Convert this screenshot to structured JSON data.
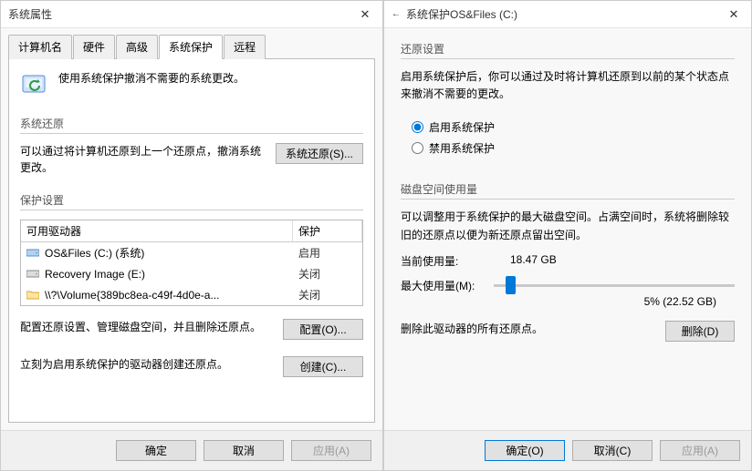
{
  "left": {
    "title": "系统属性",
    "tabs": [
      "计算机名",
      "硬件",
      "高级",
      "系统保护",
      "远程"
    ],
    "active_tab": 3,
    "intro_text": "使用系统保护撤消不需要的系统更改。",
    "section_restore": {
      "label": "系统还原",
      "text": "可以通过将计算机还原到上一个还原点，撤消系统更改。",
      "button": "系统还原(S)..."
    },
    "section_protect": {
      "label": "保护设置",
      "columns": {
        "drive": "可用驱动器",
        "protection": "保护"
      },
      "rows": [
        {
          "icon": "disk",
          "name": "OS&Files (C:) (系统)",
          "protection": "启用"
        },
        {
          "icon": "disk",
          "name": "Recovery Image (E:)",
          "protection": "关闭"
        },
        {
          "icon": "folder",
          "name": "\\\\?\\Volume{389bc8ea-c49f-4d0e-a...",
          "protection": "关闭"
        }
      ],
      "configure_text": "配置还原设置、管理磁盘空间，并且删除还原点。",
      "configure_button": "配置(O)...",
      "create_text": "立刻为启用系统保护的驱动器创建还原点。",
      "create_button": "创建(C)..."
    },
    "footer": {
      "ok": "确定",
      "cancel": "取消",
      "apply": "应用(A)"
    }
  },
  "right": {
    "title": "系统保护OS&Files (C:)",
    "section_restore": {
      "label": "还原设置",
      "desc": "启用系统保护后，你可以通过及时将计算机还原到以前的某个状态点来撤消不需要的更改。",
      "radio_enable": "启用系统保护",
      "radio_disable": "禁用系统保护",
      "selected": "enable"
    },
    "section_disk": {
      "label": "磁盘空间使用量",
      "desc": "可以调整用于系统保护的最大磁盘空间。占满空间时，系统将删除较旧的还原点以便为新还原点留出空间。",
      "current_label": "当前使用量:",
      "current_value": "18.47 GB",
      "max_label": "最大使用量(M):",
      "slider_value": 5,
      "slider_display": "5% (22.52 GB)",
      "delete_text": "删除此驱动器的所有还原点。",
      "delete_button": "删除(D)"
    },
    "footer": {
      "ok": "确定(O)",
      "cancel": "取消(C)",
      "apply": "应用(A)"
    }
  }
}
